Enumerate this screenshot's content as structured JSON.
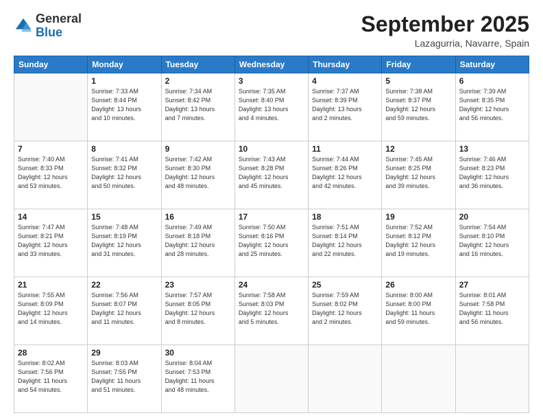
{
  "logo": {
    "general": "General",
    "blue": "Blue"
  },
  "header": {
    "month": "September 2025",
    "location": "Lazagurria, Navarre, Spain"
  },
  "days_of_week": [
    "Sunday",
    "Monday",
    "Tuesday",
    "Wednesday",
    "Thursday",
    "Friday",
    "Saturday"
  ],
  "weeks": [
    [
      {
        "day": "",
        "info": ""
      },
      {
        "day": "1",
        "info": "Sunrise: 7:33 AM\nSunset: 8:44 PM\nDaylight: 13 hours\nand 10 minutes."
      },
      {
        "day": "2",
        "info": "Sunrise: 7:34 AM\nSunset: 8:42 PM\nDaylight: 13 hours\nand 7 minutes."
      },
      {
        "day": "3",
        "info": "Sunrise: 7:35 AM\nSunset: 8:40 PM\nDaylight: 13 hours\nand 4 minutes."
      },
      {
        "day": "4",
        "info": "Sunrise: 7:37 AM\nSunset: 8:39 PM\nDaylight: 13 hours\nand 2 minutes."
      },
      {
        "day": "5",
        "info": "Sunrise: 7:38 AM\nSunset: 8:37 PM\nDaylight: 12 hours\nand 59 minutes."
      },
      {
        "day": "6",
        "info": "Sunrise: 7:39 AM\nSunset: 8:35 PM\nDaylight: 12 hours\nand 56 minutes."
      }
    ],
    [
      {
        "day": "7",
        "info": "Sunrise: 7:40 AM\nSunset: 8:33 PM\nDaylight: 12 hours\nand 53 minutes."
      },
      {
        "day": "8",
        "info": "Sunrise: 7:41 AM\nSunset: 8:32 PM\nDaylight: 12 hours\nand 50 minutes."
      },
      {
        "day": "9",
        "info": "Sunrise: 7:42 AM\nSunset: 8:30 PM\nDaylight: 12 hours\nand 48 minutes."
      },
      {
        "day": "10",
        "info": "Sunrise: 7:43 AM\nSunset: 8:28 PM\nDaylight: 12 hours\nand 45 minutes."
      },
      {
        "day": "11",
        "info": "Sunrise: 7:44 AM\nSunset: 8:26 PM\nDaylight: 12 hours\nand 42 minutes."
      },
      {
        "day": "12",
        "info": "Sunrise: 7:45 AM\nSunset: 8:25 PM\nDaylight: 12 hours\nand 39 minutes."
      },
      {
        "day": "13",
        "info": "Sunrise: 7:46 AM\nSunset: 8:23 PM\nDaylight: 12 hours\nand 36 minutes."
      }
    ],
    [
      {
        "day": "14",
        "info": "Sunrise: 7:47 AM\nSunset: 8:21 PM\nDaylight: 12 hours\nand 33 minutes."
      },
      {
        "day": "15",
        "info": "Sunrise: 7:48 AM\nSunset: 8:19 PM\nDaylight: 12 hours\nand 31 minutes."
      },
      {
        "day": "16",
        "info": "Sunrise: 7:49 AM\nSunset: 8:18 PM\nDaylight: 12 hours\nand 28 minutes."
      },
      {
        "day": "17",
        "info": "Sunrise: 7:50 AM\nSunset: 8:16 PM\nDaylight: 12 hours\nand 25 minutes."
      },
      {
        "day": "18",
        "info": "Sunrise: 7:51 AM\nSunset: 8:14 PM\nDaylight: 12 hours\nand 22 minutes."
      },
      {
        "day": "19",
        "info": "Sunrise: 7:52 AM\nSunset: 8:12 PM\nDaylight: 12 hours\nand 19 minutes."
      },
      {
        "day": "20",
        "info": "Sunrise: 7:54 AM\nSunset: 8:10 PM\nDaylight: 12 hours\nand 16 minutes."
      }
    ],
    [
      {
        "day": "21",
        "info": "Sunrise: 7:55 AM\nSunset: 8:09 PM\nDaylight: 12 hours\nand 14 minutes."
      },
      {
        "day": "22",
        "info": "Sunrise: 7:56 AM\nSunset: 8:07 PM\nDaylight: 12 hours\nand 11 minutes."
      },
      {
        "day": "23",
        "info": "Sunrise: 7:57 AM\nSunset: 8:05 PM\nDaylight: 12 hours\nand 8 minutes."
      },
      {
        "day": "24",
        "info": "Sunrise: 7:58 AM\nSunset: 8:03 PM\nDaylight: 12 hours\nand 5 minutes."
      },
      {
        "day": "25",
        "info": "Sunrise: 7:59 AM\nSunset: 8:02 PM\nDaylight: 12 hours\nand 2 minutes."
      },
      {
        "day": "26",
        "info": "Sunrise: 8:00 AM\nSunset: 8:00 PM\nDaylight: 11 hours\nand 59 minutes."
      },
      {
        "day": "27",
        "info": "Sunrise: 8:01 AM\nSunset: 7:58 PM\nDaylight: 11 hours\nand 56 minutes."
      }
    ],
    [
      {
        "day": "28",
        "info": "Sunrise: 8:02 AM\nSunset: 7:56 PM\nDaylight: 11 hours\nand 54 minutes."
      },
      {
        "day": "29",
        "info": "Sunrise: 8:03 AM\nSunset: 7:55 PM\nDaylight: 11 hours\nand 51 minutes."
      },
      {
        "day": "30",
        "info": "Sunrise: 8:04 AM\nSunset: 7:53 PM\nDaylight: 11 hours\nand 48 minutes."
      },
      {
        "day": "",
        "info": ""
      },
      {
        "day": "",
        "info": ""
      },
      {
        "day": "",
        "info": ""
      },
      {
        "day": "",
        "info": ""
      }
    ]
  ]
}
